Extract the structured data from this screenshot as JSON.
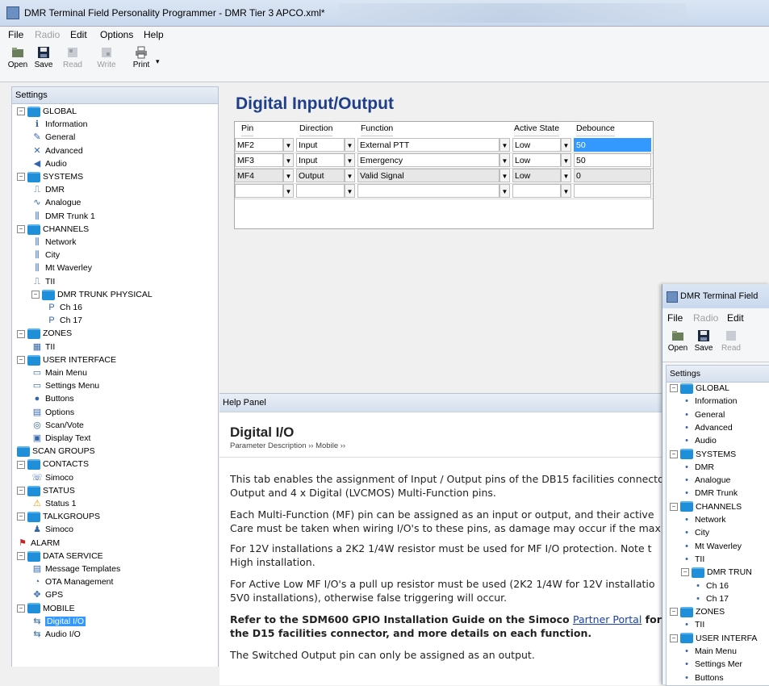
{
  "window": {
    "title": "DMR Terminal Field Personality Programmer - DMR Tier 3 APCO.xml*"
  },
  "menu": [
    "File",
    "Radio",
    "Edit",
    "Options",
    "Help"
  ],
  "toolbar": {
    "open": "Open",
    "save": "Save",
    "read": "Read",
    "write": "Write",
    "print": "Print"
  },
  "settings": {
    "header": "Settings",
    "tree": [
      {
        "label": "GLOBAL",
        "icon": "folder"
      },
      {
        "label": "Information",
        "icon": "info-icon"
      },
      {
        "label": "General",
        "icon": "pencil-icon"
      },
      {
        "label": "Advanced",
        "icon": "tools-icon"
      },
      {
        "label": "Audio",
        "icon": "speaker-icon"
      },
      {
        "label": "SYSTEMS",
        "icon": "folder"
      },
      {
        "label": "DMR",
        "icon": "pulse-icon"
      },
      {
        "label": "Analogue",
        "icon": "wave-icon"
      },
      {
        "label": "DMR Trunk 1",
        "icon": "trunk-icon"
      },
      {
        "label": "CHANNELS",
        "icon": "folder"
      },
      {
        "label": "Network",
        "icon": "trunk-icon"
      },
      {
        "label": "City",
        "icon": "trunk-icon"
      },
      {
        "label": "Mt Waverley",
        "icon": "trunk-icon"
      },
      {
        "label": "TII",
        "icon": "pulse-icon"
      },
      {
        "label": "DMR TRUNK PHYSICAL",
        "icon": "folder"
      },
      {
        "label": "Ch 16",
        "icon": "p-icon"
      },
      {
        "label": "Ch 17",
        "icon": "p-icon"
      },
      {
        "label": "ZONES",
        "icon": "folder"
      },
      {
        "label": "TII",
        "icon": "zone-icon"
      },
      {
        "label": "USER INTERFACE",
        "icon": "folder"
      },
      {
        "label": "Main Menu",
        "icon": "menu-icon"
      },
      {
        "label": "Settings Menu",
        "icon": "menu-icon"
      },
      {
        "label": "Buttons",
        "icon": "button-icon"
      },
      {
        "label": "Options",
        "icon": "options-icon"
      },
      {
        "label": "Scan/Vote",
        "icon": "scan-icon"
      },
      {
        "label": "Display Text",
        "icon": "display-icon"
      },
      {
        "label": "SCAN GROUPS",
        "icon": "folder"
      },
      {
        "label": "CONTACTS",
        "icon": "folder"
      },
      {
        "label": "Simoco",
        "icon": "phone-icon"
      },
      {
        "label": "STATUS",
        "icon": "folder"
      },
      {
        "label": "Status 1",
        "icon": "warning-icon"
      },
      {
        "label": "TALKGROUPS",
        "icon": "folder"
      },
      {
        "label": "Simoco",
        "icon": "group-icon"
      },
      {
        "label": "ALARM",
        "icon": "flag-icon"
      },
      {
        "label": "DATA SERVICE",
        "icon": "folder"
      },
      {
        "label": "Message Templates",
        "icon": "template-icon"
      },
      {
        "label": "OTA Management",
        "icon": "ota-icon"
      },
      {
        "label": "GPS",
        "icon": "gps-icon"
      },
      {
        "label": "MOBILE",
        "icon": "folder"
      },
      {
        "label": "Digital I/O",
        "icon": "io-icon"
      },
      {
        "label": "Audio I/O",
        "icon": "io-icon"
      }
    ]
  },
  "main": {
    "title": "Digital Input/Output",
    "columns": [
      "Pin",
      "Direction",
      "Function",
      "Active State",
      "Debounce"
    ],
    "rows": [
      {
        "pin": "MF2",
        "direction": "Input",
        "function": "External PTT",
        "active": "Low",
        "debounce": "50"
      },
      {
        "pin": "MF3",
        "direction": "Input",
        "function": "Emergency",
        "active": "Low",
        "debounce": "50"
      },
      {
        "pin": "MF4",
        "direction": "Output",
        "function": "Valid Signal",
        "active": "Low",
        "debounce": "0"
      },
      {
        "pin": "",
        "direction": "",
        "function": "",
        "active": "",
        "debounce": ""
      }
    ]
  },
  "help": {
    "header": "Help Panel",
    "title": "Digital I/O",
    "breadcrumb": "Parameter Description ›› Mobile ››",
    "p1a": "This tab enables the assignment of Input / Output pins of the DB15 facilities connecto",
    "p1b": "Output and 4 x Digital (LVCMOS) Multi-Function pins.",
    "p2a": "Each Multi-Function (MF) pin can be assigned as an input or output, and their active",
    "p2b": " Care must be taken when wiring I/O's to these pins, as damage may occur if the max",
    "p3a": "For 12V installations a 2K2 1/4W resistor must be used for MF I/O protection. Note t",
    "p3b": "High installation.",
    "p4a": "For Active Low MF I/O's a pull up resistor must be used (2K2 1/4W for 12V installatio",
    "p4b": "5V0 installations), otherwise false triggering will occur.",
    "p5a_pre": "Refer to the SDM600 GPIO Installation Guide on the Simoco ",
    "p5a_link": "Partner Portal",
    "p5a_post": " for impor",
    "p5b": "the D15 facilities connector, and more details on each function.",
    "p6": "The Switched Output pin can only be assigned as an output."
  },
  "window2": {
    "title": "DMR Terminal Field",
    "menu": [
      "File",
      "Radio",
      "Edit"
    ],
    "toolbar": {
      "open": "Open",
      "save": "Save",
      "read": "Read"
    },
    "settings_header": "Settings",
    "tree": [
      {
        "label": "GLOBAL"
      },
      {
        "label": "Information"
      },
      {
        "label": "General"
      },
      {
        "label": "Advanced"
      },
      {
        "label": "Audio"
      },
      {
        "label": "SYSTEMS"
      },
      {
        "label": "DMR"
      },
      {
        "label": "Analogue"
      },
      {
        "label": "DMR Trunk"
      },
      {
        "label": "CHANNELS"
      },
      {
        "label": "Network"
      },
      {
        "label": "City"
      },
      {
        "label": "Mt Waverley"
      },
      {
        "label": "TII"
      },
      {
        "label": "DMR TRUN"
      },
      {
        "label": "Ch 16"
      },
      {
        "label": "Ch 17"
      },
      {
        "label": "ZONES"
      },
      {
        "label": "TII"
      },
      {
        "label": "USER INTERFA"
      },
      {
        "label": "Main Menu"
      },
      {
        "label": "Settings Mer"
      },
      {
        "label": "Buttons"
      }
    ]
  }
}
